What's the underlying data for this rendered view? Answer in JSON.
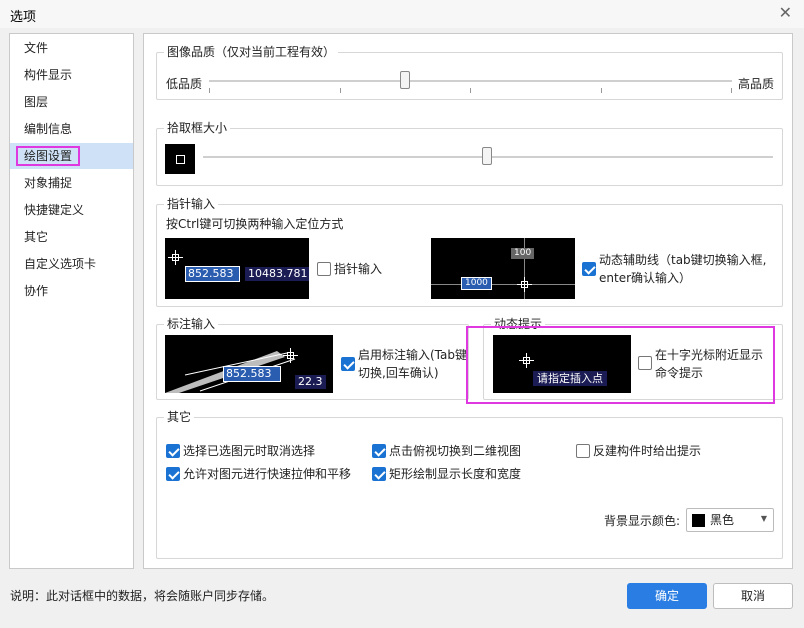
{
  "window": {
    "title": "选项",
    "close_glyph": "✕"
  },
  "sidebar": {
    "items": [
      {
        "label": "文件"
      },
      {
        "label": "构件显示"
      },
      {
        "label": "图层"
      },
      {
        "label": "编制信息"
      },
      {
        "label": "绘图设置",
        "selected": true
      },
      {
        "label": "对象捕捉"
      },
      {
        "label": "快捷键定义"
      },
      {
        "label": "其它"
      },
      {
        "label": "自定义选项卡"
      },
      {
        "label": "协作"
      }
    ]
  },
  "image_quality": {
    "title": "图像品质（仅对当前工程有效）",
    "low_label": "低品质",
    "high_label": "高品质",
    "level": 0.43
  },
  "pick_box": {
    "title": "拾取框大小",
    "level": 0.5
  },
  "pointer_input": {
    "title": "指针输入",
    "hint": "按Ctrl键可切换两种输入定位方式",
    "preview_value_1": "852.583",
    "preview_value_2": "10483.781",
    "pointer_checkbox_label": "指针输入",
    "pointer_checked": false,
    "dyn_preview_top": "100",
    "dyn_preview_left": "1000",
    "dynamic_label_line1": "动态辅助线（tab键切换输入框,",
    "dynamic_label_line2": "enter确认输入）",
    "dynamic_checked": true
  },
  "dimension_input": {
    "title": "标注输入",
    "preview_value_1": "852.583",
    "preview_value_2": "22.3",
    "checkbox_label_line1": "启用标注输入(Tab键",
    "checkbox_label_line2": "切换,回车确认)",
    "checked": true
  },
  "dynamic_prompt": {
    "title": "动态提示",
    "preview_text": "请指定插入点",
    "checkbox_label_line1": "在十字光标附近显示",
    "checkbox_label_line2": "命令提示",
    "checked": false
  },
  "other": {
    "title": "其它",
    "options": [
      {
        "label": "选择已选图元时取消选择",
        "checked": true
      },
      {
        "label": "点击俯视切换到二维视图",
        "checked": true
      },
      {
        "label": "反建构件时给出提示",
        "checked": false
      },
      {
        "label": "允许对图元进行快速拉伸和平移",
        "checked": true
      },
      {
        "label": "矩形绘制显示长度和宽度",
        "checked": true
      }
    ],
    "bg_color_label": "背景显示颜色:",
    "bg_color_value": "黑色",
    "bg_color_hex": "#000000"
  },
  "footer": {
    "note": "说明：此对话框中的数据，将会随账户同步存储。",
    "ok_label": "确定",
    "cancel_label": "取消"
  }
}
